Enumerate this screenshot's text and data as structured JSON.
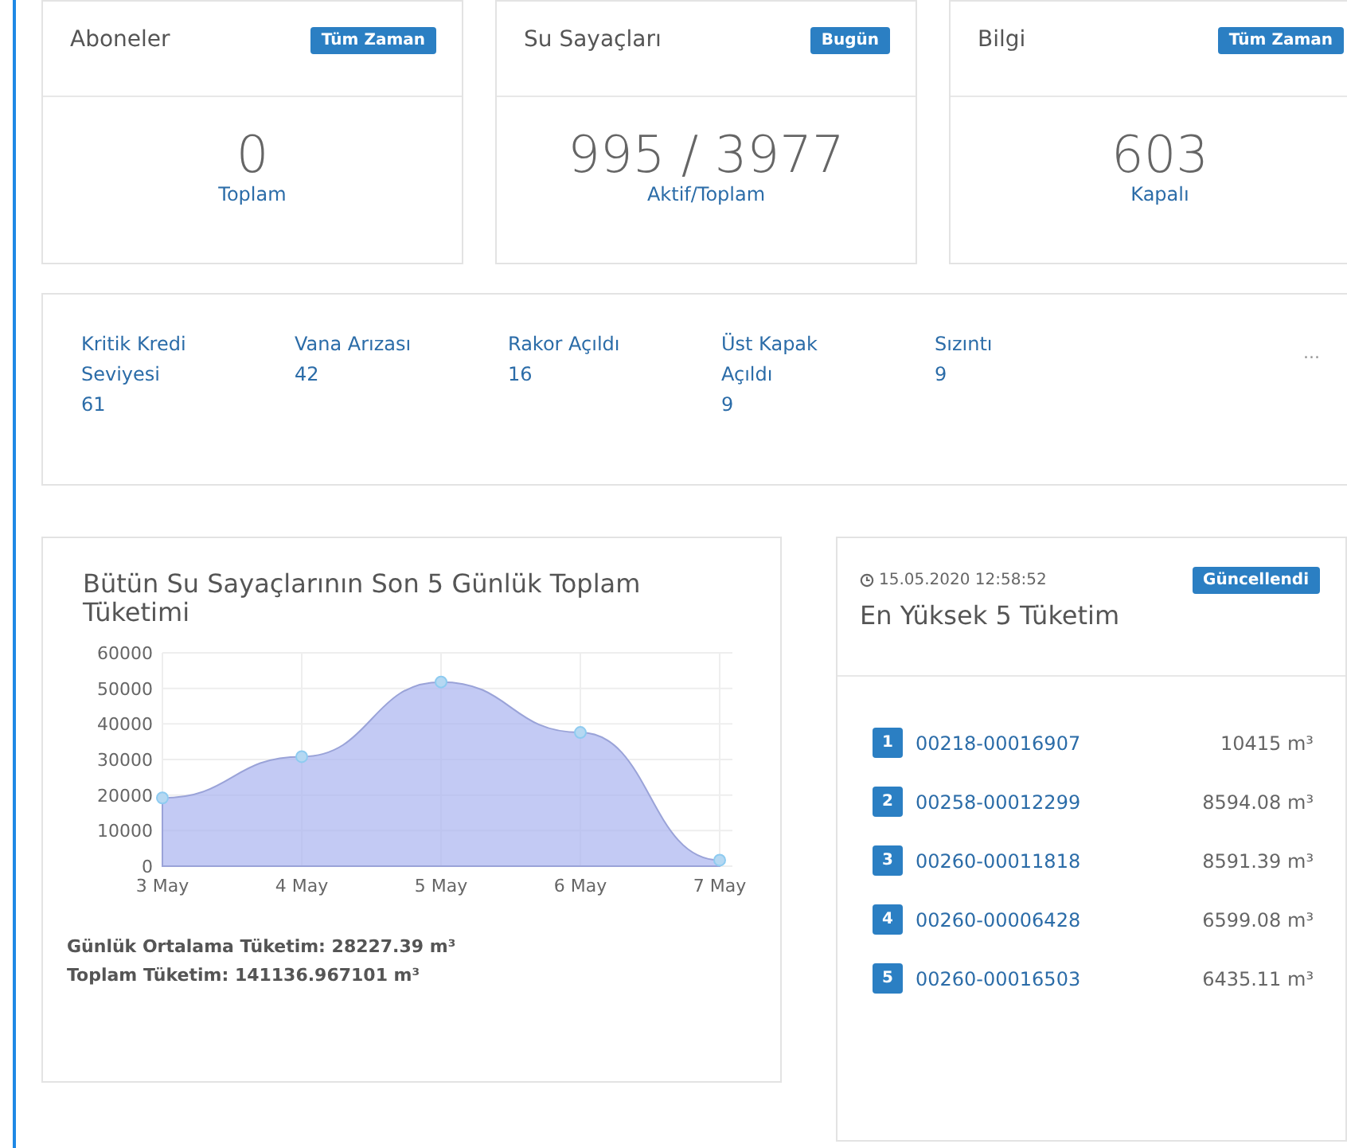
{
  "stat_cards": [
    {
      "title": "Aboneler",
      "badge": "Tüm Zaman",
      "value": "0",
      "caption": "Toplam"
    },
    {
      "title": "Su Sayaçları",
      "badge": "Bugün",
      "value": "995 / 3977",
      "caption": "Aktif/Toplam"
    },
    {
      "title": "Bilgi",
      "badge": "Tüm Zaman",
      "value": "603",
      "caption": "Kapalı"
    }
  ],
  "alarms": [
    {
      "label": "Kritik Kredi Seviyesi",
      "count": "61"
    },
    {
      "label": "Vana Arızası",
      "count": "42"
    },
    {
      "label": "Rakor Açıldı",
      "count": "16"
    },
    {
      "label": "Üst Kapak Açıldı",
      "count": "9"
    },
    {
      "label": "Sızıntı",
      "count": "9"
    }
  ],
  "alarms_more": "...",
  "consumption_panel": {
    "title": "Bütün Su Sayaçlarının Son 5 Günlük Toplam Tüketimi",
    "chart_data": {
      "type": "area",
      "grid": true,
      "categories": [
        "3 May",
        "4 May",
        "5 May",
        "6 May",
        "7 May"
      ],
      "values": [
        19200,
        30800,
        51800,
        37600,
        1700
      ],
      "ylim": [
        0,
        60000
      ],
      "yticks": [
        0,
        10000,
        20000,
        30000,
        40000,
        50000,
        60000
      ]
    },
    "daily_average": "Günlük Ortalama Tüketim: 28227.39 m³",
    "total": "Toplam Tüketim: 141136.967101 m³"
  },
  "top_panel": {
    "timestamp": "15.05.2020 12:58:52",
    "badge": "Güncellendi",
    "title": "En Yüksek 5 Tüketim",
    "rows": [
      {
        "rank": "1",
        "meter": "00218-00016907",
        "value": "10415 m³"
      },
      {
        "rank": "2",
        "meter": "00258-00012299",
        "value": "8594.08 m³"
      },
      {
        "rank": "3",
        "meter": "00260-00011818",
        "value": "8591.39 m³"
      },
      {
        "rank": "4",
        "meter": "00260-00006428",
        "value": "6599.08 m³"
      },
      {
        "rank": "5",
        "meter": "00260-00016503",
        "value": "6435.11 m³"
      }
    ]
  }
}
